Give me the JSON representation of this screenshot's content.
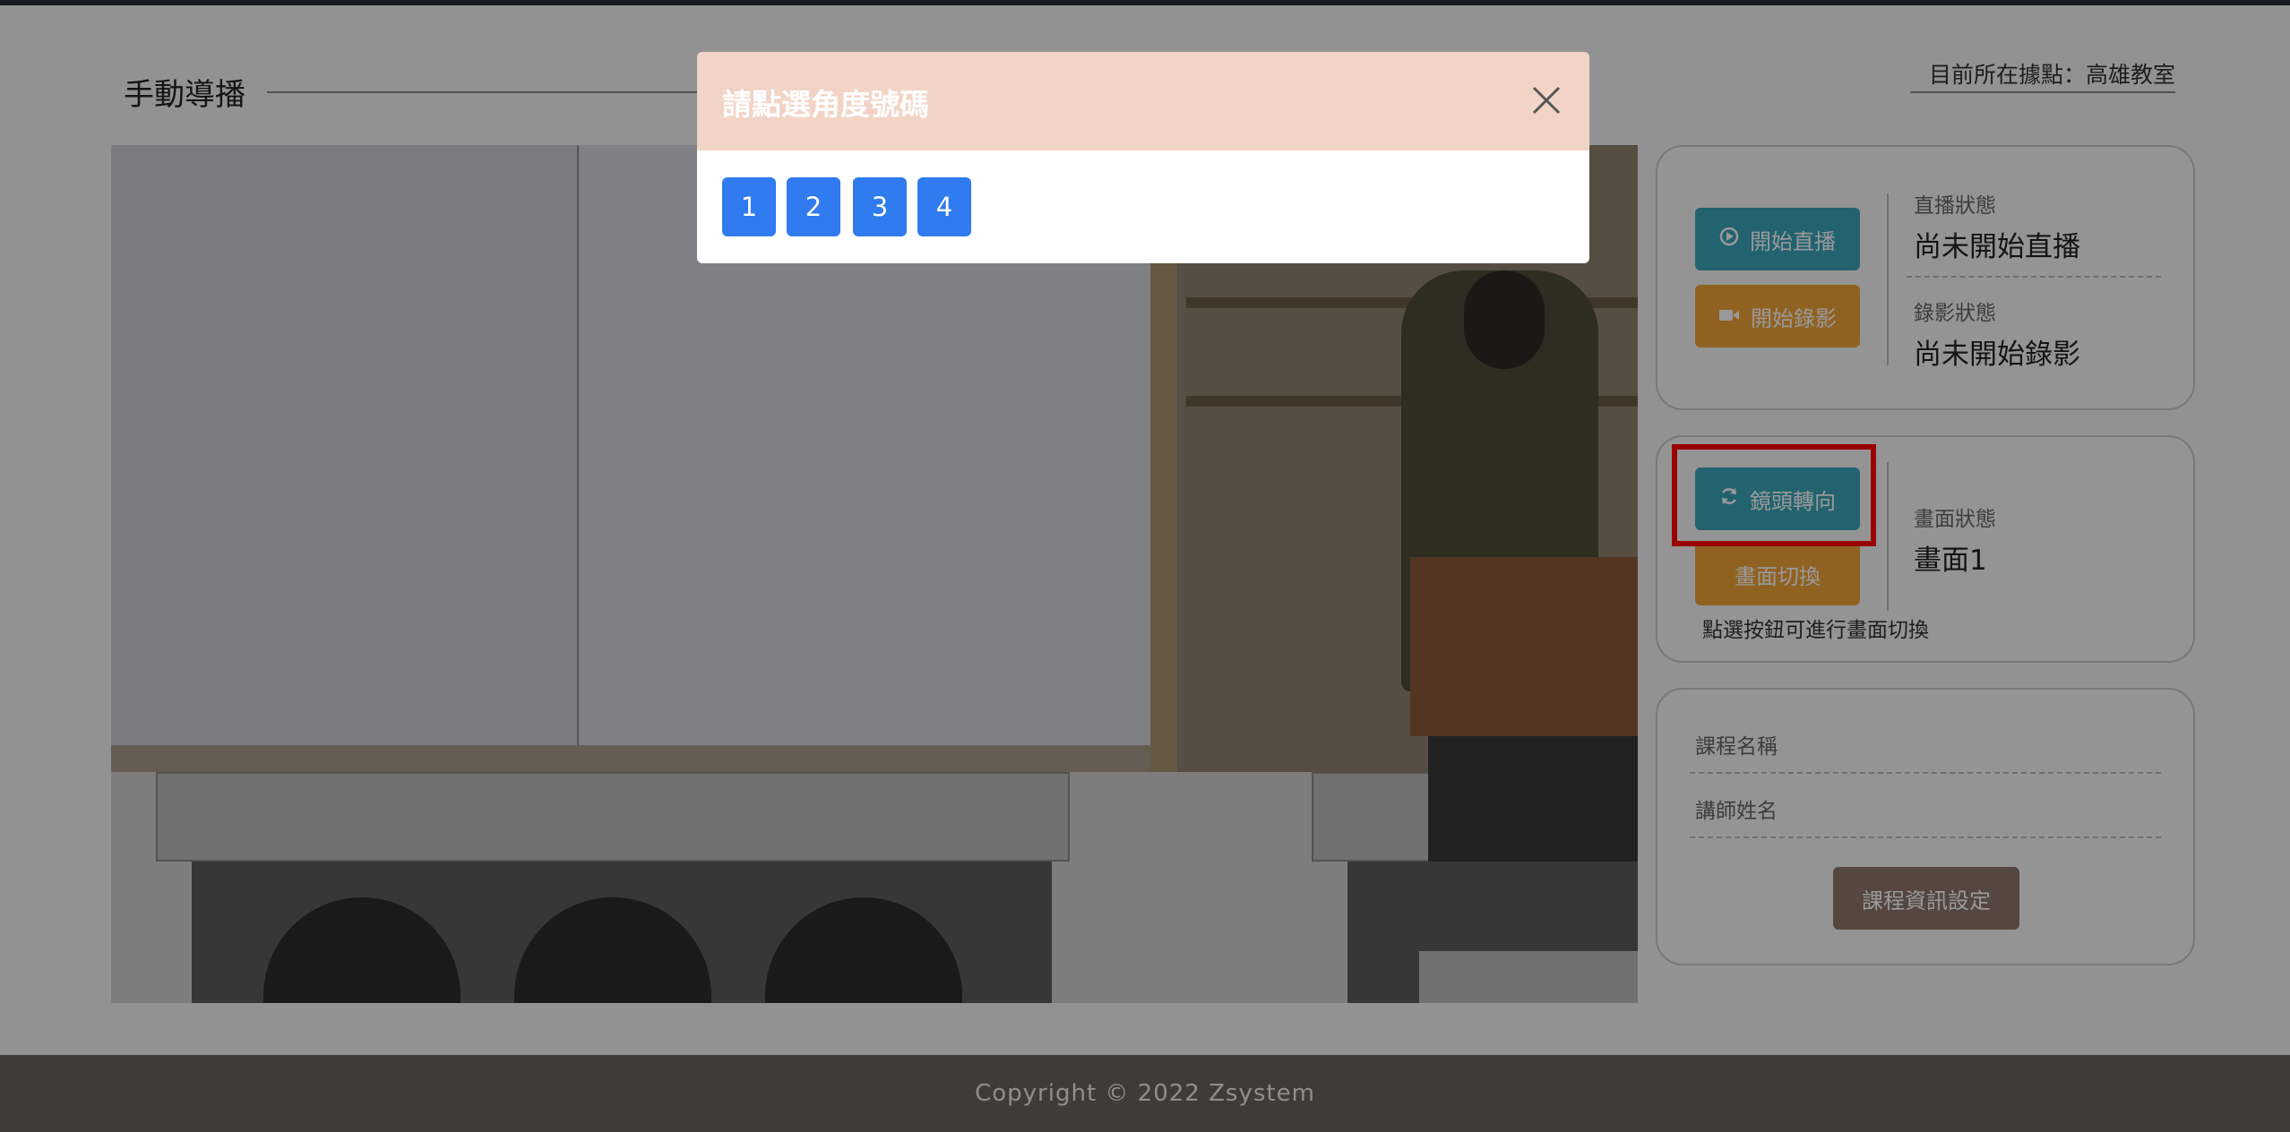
{
  "page": {
    "title": "手動導播",
    "location": "目前所在據點：高雄教室"
  },
  "broadcast_panel": {
    "start_live_label": "開始直播",
    "start_record_label": "開始錄影",
    "live_status_label": "直播狀態",
    "live_status_value": "尚未開始直播",
    "record_status_label": "錄影狀態",
    "record_status_value": "尚未開始錄影"
  },
  "camera_panel": {
    "camera_direction_label": "鏡頭轉向",
    "switch_screen_label": "畫面切換",
    "screen_status_label": "畫面狀態",
    "screen_status_value": "畫面1",
    "hint": "點選按鈕可進行畫面切換"
  },
  "course_panel": {
    "course_name_label": "課程名稱",
    "teacher_name_label": "講師姓名",
    "settings_button_label": "課程資訊設定"
  },
  "footer": {
    "copyright": "Copyright © 2022 Zsystem"
  },
  "modal": {
    "title": "請點選角度號碼",
    "options": [
      "1",
      "2",
      "3",
      "4"
    ]
  },
  "colors": {
    "teal": "#3aa6b9",
    "orange": "#f0a33a",
    "brown": "#8e756b",
    "blue": "#2f7bef",
    "highlight": "#ff0000"
  },
  "icons": {
    "live": "play-circle-icon",
    "record": "video-camera-icon",
    "camera_direction": "refresh-icon",
    "modal_close": "close-icon"
  }
}
